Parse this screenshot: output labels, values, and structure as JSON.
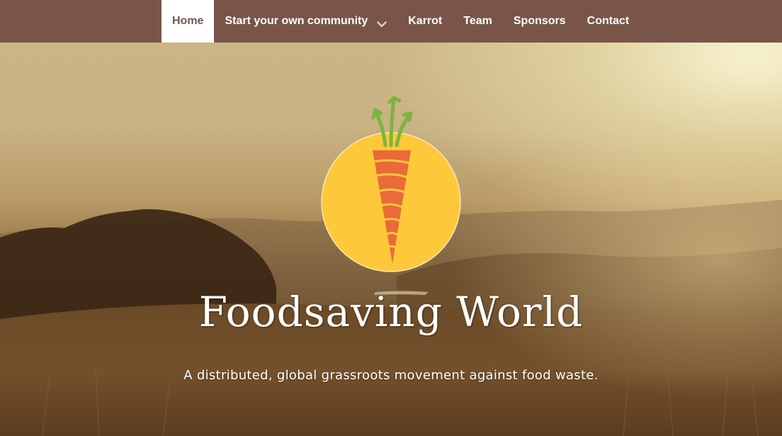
{
  "nav": {
    "items": [
      {
        "label": "Home",
        "active": true
      },
      {
        "label": "Start your own community",
        "has_dropdown": true
      },
      {
        "label": "Karrot"
      },
      {
        "label": "Team"
      },
      {
        "label": "Sponsors"
      },
      {
        "label": "Contact"
      }
    ],
    "dropdown_icon": "chevron-down-icon"
  },
  "hero": {
    "logo_icon": "carrot-icon",
    "title": "Foodsaving World",
    "subtitle": "A distributed, global grassroots movement against food waste."
  },
  "colors": {
    "navbar": "#795548",
    "active_tab": "#ffffff",
    "logo_circle": "#fdc83a",
    "carrot": "#ea6a3a",
    "carrot_leaves": "#7cb342"
  }
}
